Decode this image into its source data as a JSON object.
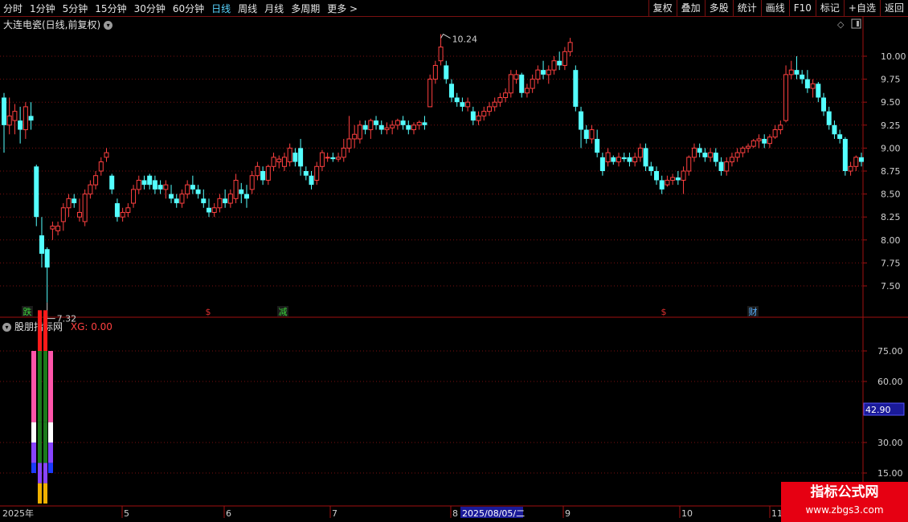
{
  "toolbar": {
    "periods": [
      "分时",
      "1分钟",
      "5分钟",
      "15分钟",
      "30分钟",
      "60分钟",
      "日线",
      "周线",
      "月线",
      "多周期",
      "更多 >"
    ],
    "active_period": "日线",
    "actions": [
      "复权",
      "叠加",
      "多股",
      "统计",
      "画线",
      "F10",
      "标记",
      "+自选",
      "返回"
    ]
  },
  "main_panel": {
    "title": "大连电瓷(日线,前复权)",
    "high_label": "10.24",
    "low_label": "7.32",
    "y_ticks": [
      "10.00",
      "9.75",
      "9.50",
      "9.25",
      "9.00",
      "8.75",
      "8.50",
      "8.25",
      "8.00",
      "7.75",
      "7.50"
    ],
    "markers": [
      {
        "text": "跌",
        "color": "#3ad23a"
      },
      {
        "text": "$",
        "color": "#e03030"
      },
      {
        "text": "减",
        "color": "#3ad23a"
      },
      {
        "text": "$",
        "color": "#e03030"
      },
      {
        "text": "财",
        "color": "#59b0ff"
      }
    ]
  },
  "indicator_panel": {
    "name": "股朋指标网",
    "series_label": "XG: 0.00",
    "y_ticks": [
      "75.00",
      "60.00",
      "30.00",
      "15.00"
    ],
    "current_value": "42.90"
  },
  "date_axis": {
    "labels": [
      "2025年",
      "5",
      "6",
      "7",
      "8",
      "2025/08/05/二",
      "9",
      "10",
      "11"
    ]
  },
  "watermark": {
    "title": "指标公式网",
    "url": "www.zbgs3.com"
  },
  "colors": {
    "up": "#ff4040",
    "down": "#54ffff",
    "grid": "#7a1010",
    "axis": "#a01010"
  },
  "chart_data": {
    "type": "candlestick",
    "title": "大连电瓷(日线,前复权)",
    "ylim": [
      7.32,
      10.24
    ],
    "y_ticks": [
      7.5,
      7.75,
      8.0,
      8.25,
      8.5,
      8.75,
      9.0,
      9.25,
      9.5,
      9.75,
      10.0
    ],
    "max": 10.24,
    "min": 7.32,
    "ohlc": [
      [
        9.55,
        9.6,
        8.95,
        9.25
      ],
      [
        9.25,
        9.55,
        9.15,
        9.35
      ],
      [
        9.3,
        9.48,
        9.15,
        9.4
      ],
      [
        9.3,
        9.45,
        9.05,
        9.2
      ],
      [
        9.2,
        9.5,
        9.1,
        9.45
      ],
      [
        9.35,
        9.5,
        9.2,
        9.3
      ],
      [
        8.8,
        8.82,
        8.15,
        8.25
      ],
      [
        8.05,
        8.25,
        7.7,
        7.85
      ],
      [
        7.9,
        7.92,
        7.32,
        7.7
      ],
      [
        8.12,
        8.2,
        8.0,
        8.15
      ],
      [
        8.1,
        8.2,
        8.05,
        8.15
      ],
      [
        8.2,
        8.4,
        8.1,
        8.35
      ],
      [
        8.35,
        8.5,
        8.25,
        8.45
      ],
      [
        8.45,
        8.5,
        8.35,
        8.4
      ],
      [
        8.25,
        8.45,
        8.2,
        8.3
      ],
      [
        8.2,
        8.55,
        8.15,
        8.5
      ],
      [
        8.5,
        8.65,
        8.45,
        8.6
      ],
      [
        8.6,
        8.75,
        8.55,
        8.7
      ],
      [
        8.75,
        8.9,
        8.7,
        8.85
      ],
      [
        8.9,
        9.0,
        8.85,
        8.95
      ],
      [
        8.7,
        8.72,
        8.5,
        8.55
      ],
      [
        8.4,
        8.45,
        8.2,
        8.25
      ],
      [
        8.25,
        8.35,
        8.2,
        8.3
      ],
      [
        8.3,
        8.4,
        8.25,
        8.35
      ],
      [
        8.4,
        8.6,
        8.35,
        8.55
      ],
      [
        8.55,
        8.7,
        8.5,
        8.65
      ],
      [
        8.65,
        8.7,
        8.55,
        8.6
      ],
      [
        8.7,
        8.72,
        8.55,
        8.6
      ],
      [
        8.65,
        8.7,
        8.5,
        8.55
      ],
      [
        8.6,
        8.65,
        8.5,
        8.55
      ],
      [
        8.55,
        8.65,
        8.45,
        8.6
      ],
      [
        8.5,
        8.6,
        8.4,
        8.45
      ],
      [
        8.45,
        8.5,
        8.35,
        8.4
      ],
      [
        8.4,
        8.55,
        8.35,
        8.5
      ],
      [
        8.5,
        8.65,
        8.45,
        8.6
      ],
      [
        8.6,
        8.7,
        8.5,
        8.55
      ],
      [
        8.55,
        8.6,
        8.45,
        8.5
      ],
      [
        8.45,
        8.55,
        8.35,
        8.4
      ],
      [
        8.35,
        8.45,
        8.25,
        8.3
      ],
      [
        8.3,
        8.4,
        8.25,
        8.35
      ],
      [
        8.35,
        8.5,
        8.3,
        8.45
      ],
      [
        8.45,
        8.55,
        8.35,
        8.4
      ],
      [
        8.4,
        8.55,
        8.35,
        8.5
      ],
      [
        8.45,
        8.72,
        8.4,
        8.65
      ],
      [
        8.55,
        8.62,
        8.4,
        8.5
      ],
      [
        8.5,
        8.6,
        8.35,
        8.45
      ],
      [
        8.55,
        8.75,
        8.5,
        8.7
      ],
      [
        8.7,
        8.85,
        8.65,
        8.8
      ],
      [
        8.75,
        8.8,
        8.6,
        8.65
      ],
      [
        8.65,
        8.82,
        8.6,
        8.8
      ],
      [
        8.8,
        8.95,
        8.75,
        8.9
      ],
      [
        8.85,
        8.92,
        8.78,
        8.88
      ],
      [
        8.8,
        8.95,
        8.75,
        8.9
      ],
      [
        8.85,
        9.05,
        8.8,
        9.0
      ],
      [
        8.95,
        9.0,
        8.8,
        8.85
      ],
      [
        9.0,
        9.1,
        8.7,
        8.8
      ],
      [
        8.75,
        8.8,
        8.65,
        8.7
      ],
      [
        8.7,
        8.75,
        8.55,
        8.6
      ],
      [
        8.65,
        8.85,
        8.6,
        8.8
      ],
      [
        8.8,
        8.98,
        8.75,
        8.95
      ],
      [
        8.9,
        8.95,
        8.85,
        8.9
      ],
      [
        8.9,
        8.95,
        8.85,
        8.88
      ],
      [
        8.88,
        8.95,
        8.85,
        8.9
      ],
      [
        8.9,
        9.1,
        8.85,
        9.0
      ],
      [
        9.0,
        9.35,
        8.95,
        9.1
      ],
      [
        9.1,
        9.25,
        9.0,
        9.15
      ],
      [
        9.1,
        9.3,
        9.05,
        9.25
      ],
      [
        9.25,
        9.3,
        9.15,
        9.2
      ],
      [
        9.2,
        9.32,
        9.1,
        9.3
      ],
      [
        9.3,
        9.35,
        9.2,
        9.25
      ],
      [
        9.25,
        9.3,
        9.15,
        9.2
      ],
      [
        9.2,
        9.28,
        9.15,
        9.22
      ],
      [
        9.22,
        9.3,
        9.15,
        9.25
      ],
      [
        9.25,
        9.32,
        9.2,
        9.3
      ],
      [
        9.3,
        9.35,
        9.2,
        9.25
      ],
      [
        9.25,
        9.3,
        9.15,
        9.2
      ],
      [
        9.2,
        9.28,
        9.15,
        9.25
      ],
      [
        9.25,
        9.3,
        9.2,
        9.28
      ],
      [
        9.28,
        9.35,
        9.2,
        9.25
      ],
      [
        9.45,
        9.8,
        9.45,
        9.75
      ],
      [
        9.75,
        9.95,
        9.7,
        9.9
      ],
      [
        9.95,
        10.24,
        9.9,
        10.1
      ],
      [
        9.9,
        9.95,
        9.7,
        9.75
      ],
      [
        9.7,
        9.75,
        9.5,
        9.55
      ],
      [
        9.55,
        9.6,
        9.45,
        9.5
      ],
      [
        9.5,
        9.55,
        9.4,
        9.45
      ],
      [
        9.45,
        9.55,
        9.4,
        9.5
      ],
      [
        9.4,
        9.45,
        9.25,
        9.3
      ],
      [
        9.3,
        9.4,
        9.25,
        9.35
      ],
      [
        9.35,
        9.45,
        9.3,
        9.4
      ],
      [
        9.4,
        9.5,
        9.35,
        9.45
      ],
      [
        9.45,
        9.55,
        9.4,
        9.5
      ],
      [
        9.5,
        9.6,
        9.45,
        9.55
      ],
      [
        9.55,
        9.65,
        9.5,
        9.6
      ],
      [
        9.6,
        9.85,
        9.55,
        9.8
      ],
      [
        9.75,
        9.85,
        9.7,
        9.8
      ],
      [
        9.8,
        9.82,
        9.55,
        9.6
      ],
      [
        9.6,
        9.7,
        9.55,
        9.65
      ],
      [
        9.65,
        9.8,
        9.6,
        9.75
      ],
      [
        9.75,
        9.9,
        9.7,
        9.85
      ],
      [
        9.85,
        9.95,
        9.75,
        9.8
      ],
      [
        9.8,
        9.9,
        9.7,
        9.85
      ],
      [
        9.85,
        10.0,
        9.8,
        9.95
      ],
      [
        9.95,
        10.05,
        9.85,
        9.9
      ],
      [
        9.9,
        10.1,
        9.85,
        10.05
      ],
      [
        10.05,
        10.2,
        10.0,
        10.15
      ],
      [
        9.85,
        9.9,
        9.4,
        9.45
      ],
      [
        9.4,
        9.45,
        9.0,
        9.2
      ],
      [
        9.2,
        9.25,
        9.05,
        9.1
      ],
      [
        9.1,
        9.25,
        9.05,
        9.2
      ],
      [
        9.1,
        9.2,
        8.9,
        8.95
      ],
      [
        8.9,
        8.95,
        8.7,
        8.75
      ],
      [
        8.85,
        9.0,
        8.8,
        8.95
      ],
      [
        8.9,
        8.92,
        8.82,
        8.85
      ],
      [
        8.85,
        8.95,
        8.8,
        8.9
      ],
      [
        8.9,
        8.95,
        8.85,
        8.88
      ],
      [
        8.9,
        8.95,
        8.8,
        8.85
      ],
      [
        8.85,
        8.95,
        8.8,
        8.9
      ],
      [
        8.9,
        9.05,
        8.85,
        9.0
      ],
      [
        9.0,
        9.05,
        8.75,
        8.8
      ],
      [
        8.8,
        8.85,
        8.7,
        8.75
      ],
      [
        8.75,
        8.8,
        8.6,
        8.65
      ],
      [
        8.65,
        8.7,
        8.5,
        8.55
      ],
      [
        8.6,
        8.7,
        8.58,
        8.65
      ],
      [
        8.65,
        8.72,
        8.6,
        8.68
      ],
      [
        8.68,
        8.75,
        8.6,
        8.65
      ],
      [
        8.65,
        8.8,
        8.5,
        8.75
      ],
      [
        8.75,
        8.92,
        8.7,
        8.9
      ],
      [
        8.9,
        9.05,
        8.85,
        9.0
      ],
      [
        9.0,
        9.05,
        8.9,
        8.95
      ],
      [
        8.95,
        9.0,
        8.85,
        8.9
      ],
      [
        8.9,
        9.0,
        8.85,
        8.95
      ],
      [
        8.95,
        9.0,
        8.8,
        8.85
      ],
      [
        8.85,
        8.9,
        8.7,
        8.75
      ],
      [
        8.75,
        8.9,
        8.7,
        8.85
      ],
      [
        8.85,
        8.95,
        8.8,
        8.9
      ],
      [
        8.9,
        9.0,
        8.85,
        8.95
      ],
      [
        8.95,
        9.02,
        8.9,
        9.0
      ],
      [
        9.0,
        9.05,
        8.95,
        9.02
      ],
      [
        9.02,
        9.1,
        9.0,
        9.08
      ],
      [
        9.08,
        9.15,
        9.0,
        9.1
      ],
      [
        9.1,
        9.15,
        9.0,
        9.05
      ],
      [
        9.05,
        9.15,
        9.0,
        9.12
      ],
      [
        9.12,
        9.25,
        9.1,
        9.2
      ],
      [
        9.2,
        9.3,
        9.15,
        9.25
      ],
      [
        9.3,
        9.9,
        9.28,
        9.8
      ],
      [
        9.8,
        9.95,
        9.75,
        9.85
      ],
      [
        9.85,
        10.0,
        9.75,
        9.8
      ],
      [
        9.8,
        9.85,
        9.7,
        9.75
      ],
      [
        9.75,
        9.85,
        9.6,
        9.65
      ],
      [
        9.65,
        9.75,
        9.55,
        9.7
      ],
      [
        9.7,
        9.72,
        9.5,
        9.55
      ],
      [
        9.55,
        9.6,
        9.35,
        9.4
      ],
      [
        9.4,
        9.45,
        9.2,
        9.25
      ],
      [
        9.25,
        9.3,
        9.1,
        9.15
      ],
      [
        9.15,
        9.2,
        9.05,
        9.1
      ],
      [
        9.1,
        9.12,
        8.7,
        8.75
      ],
      [
        8.75,
        8.85,
        8.7,
        8.8
      ],
      [
        8.8,
        8.92,
        8.75,
        8.9
      ],
      [
        8.9,
        8.95,
        8.8,
        8.85
      ]
    ],
    "indicator": {
      "series_name": "XG",
      "value": 0.0,
      "ylim": [
        0,
        100
      ],
      "ticks": [
        15,
        30,
        60,
        75
      ],
      "bars": [
        {
          "segments": [
            [
              15,
              20,
              "#1b3aff"
            ],
            [
              20,
              30,
              "#8844ff"
            ],
            [
              30,
              40,
              "#ffffff"
            ],
            [
              40,
              75,
              "#ff55aa"
            ]
          ]
        },
        {
          "segments": [
            [
              0,
              10,
              "#f0b000"
            ],
            [
              10,
              20,
              "#8844ff"
            ],
            [
              20,
              40,
              "#1b7a1b"
            ],
            [
              40,
              75,
              "#1b7a1b"
            ],
            [
              75,
              95,
              "#ff1a1a"
            ]
          ]
        },
        {
          "segments": [
            [
              0,
              10,
              "#f0b000"
            ],
            [
              10,
              20,
              "#8844ff"
            ],
            [
              20,
              40,
              "#1b7a1b"
            ],
            [
              40,
              75,
              "#1b7a1b"
            ],
            [
              75,
              95,
              "#ff1a1a"
            ]
          ]
        },
        {
          "segments": [
            [
              15,
              20,
              "#1b3aff"
            ],
            [
              20,
              30,
              "#8844ff"
            ],
            [
              30,
              40,
              "#ffffff"
            ],
            [
              40,
              75,
              "#ff55aa"
            ]
          ]
        }
      ]
    }
  }
}
